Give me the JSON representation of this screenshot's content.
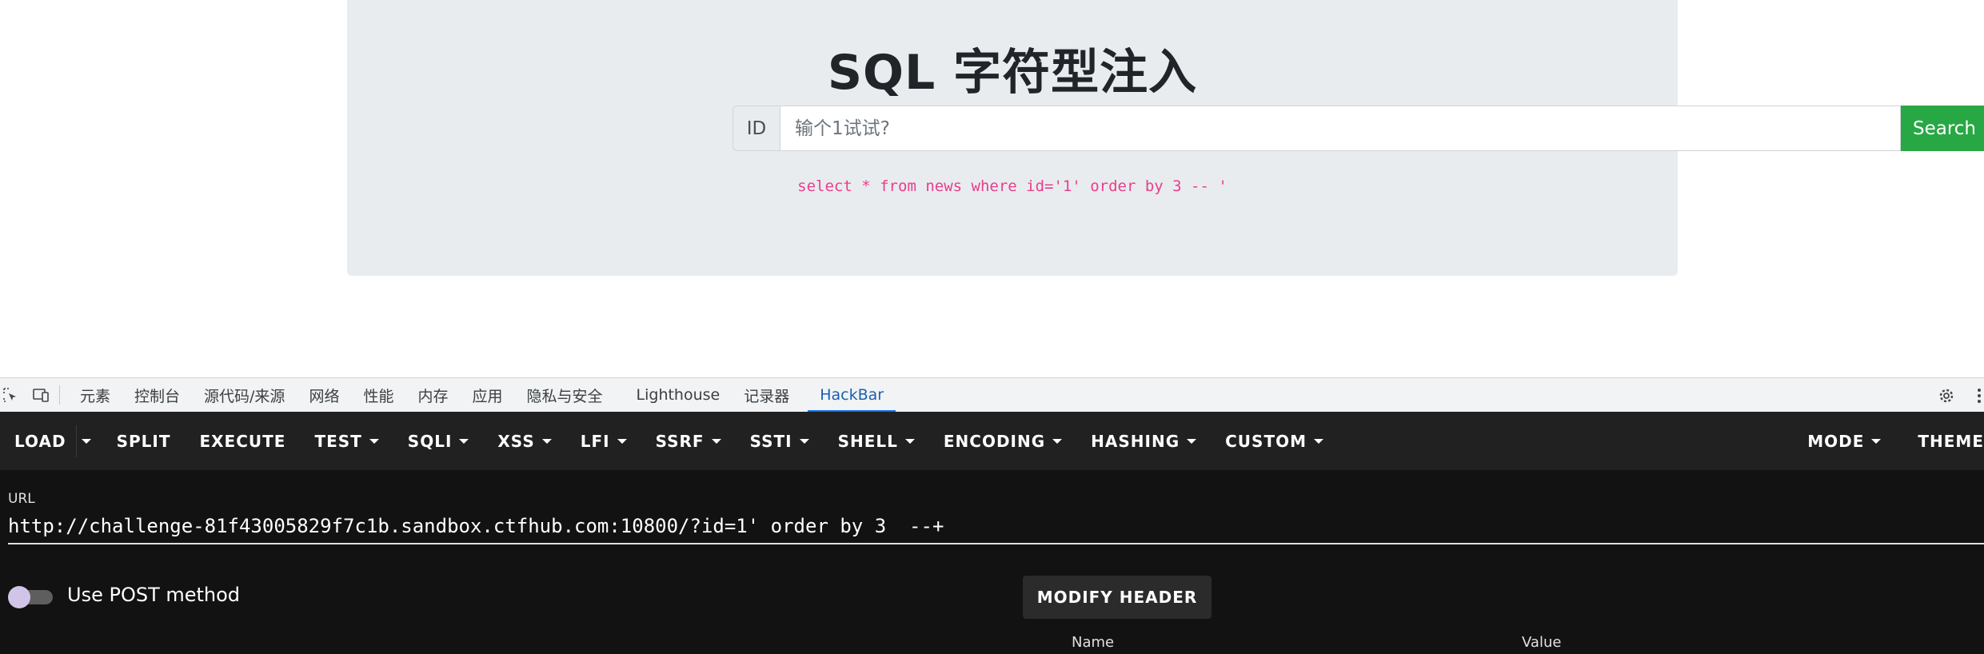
{
  "page": {
    "title": "SQL 字符型注入",
    "id_label": "ID",
    "input_placeholder": "输个1试试?",
    "search_label": "Search",
    "sql_query": "select * from news where id='1' order by 3 -- '"
  },
  "devtools": {
    "tabs": [
      "元素",
      "控制台",
      "源代码/来源",
      "网络",
      "性能",
      "内存",
      "应用",
      "隐私与安全",
      "Lighthouse",
      "记录器",
      "HackBar"
    ],
    "active_tab": "HackBar"
  },
  "hackbar": {
    "menu": [
      {
        "label": "LOAD",
        "dropdown": false
      },
      {
        "label": "SPLIT",
        "dropdown": false
      },
      {
        "label": "EXECUTE",
        "dropdown": false
      },
      {
        "label": "TEST",
        "dropdown": true
      },
      {
        "label": "SQLI",
        "dropdown": true
      },
      {
        "label": "XSS",
        "dropdown": true
      },
      {
        "label": "LFI",
        "dropdown": true
      },
      {
        "label": "SSRF",
        "dropdown": true
      },
      {
        "label": "SSTI",
        "dropdown": true
      },
      {
        "label": "SHELL",
        "dropdown": true
      },
      {
        "label": "ENCODING",
        "dropdown": true
      },
      {
        "label": "HASHING",
        "dropdown": true
      },
      {
        "label": "CUSTOM",
        "dropdown": true
      }
    ],
    "mode_label": "MODE",
    "theme_label": "THEME",
    "url_label": "URL",
    "url_value": "http://challenge-81f43005829f7c1b.sandbox.ctfhub.com:10800/?id=1' order by 3  --+",
    "post_label": "Use POST method",
    "modify_header_label": "MODIFY HEADER",
    "header_columns": [
      "Name",
      "Value"
    ]
  },
  "colors": {
    "search_button": "#28a745",
    "sql_text": "#e83e8c",
    "active_tab": "#1a73e8",
    "hackbar_menu_bg": "#212121",
    "hackbar_body_bg": "#121212"
  },
  "icons": [
    "inspect-element-icon",
    "device-toolbar-icon",
    "settings-gear-icon",
    "more-vertical-icon",
    "load-dropdown-caret-icon"
  ]
}
